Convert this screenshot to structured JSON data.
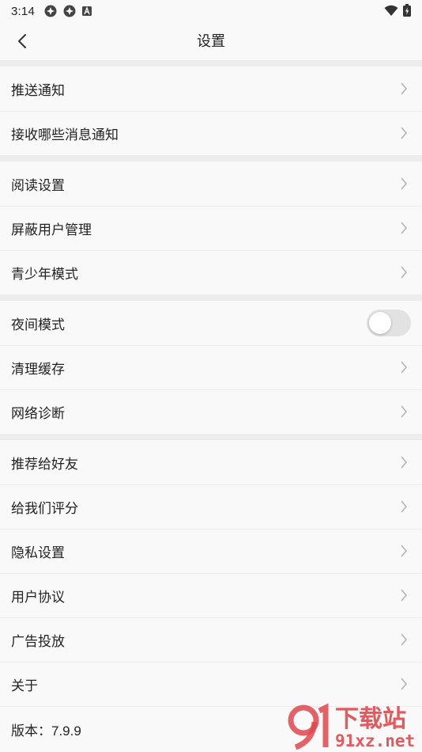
{
  "status": {
    "time": "3:14"
  },
  "nav": {
    "title": "设置"
  },
  "groups": [
    {
      "items": [
        {
          "label": "推送通知"
        },
        {
          "label": "接收哪些消息通知"
        }
      ]
    },
    {
      "items": [
        {
          "label": "阅读设置"
        },
        {
          "label": "屏蔽用户管理"
        },
        {
          "label": "青少年模式"
        }
      ]
    },
    {
      "items": [
        {
          "label": "夜间模式",
          "toggle": false
        },
        {
          "label": "清理缓存"
        },
        {
          "label": "网络诊断"
        }
      ]
    },
    {
      "items": [
        {
          "label": "推荐给好友"
        },
        {
          "label": "给我们评分"
        },
        {
          "label": "隐私设置"
        },
        {
          "label": "用户协议"
        },
        {
          "label": "广告投放"
        },
        {
          "label": "关于"
        }
      ]
    }
  ],
  "version": {
    "label": "版本：7.9.9"
  },
  "watermark": {
    "text_top": "下载站",
    "text_bottom": "91xz.net"
  },
  "colors": {
    "background": "#f9f9f9",
    "divider": "#ececec",
    "text": "#222222",
    "chevron": "#b5b5b5",
    "toggle_off": "#e2e2e2",
    "watermark": "#e0484e"
  }
}
